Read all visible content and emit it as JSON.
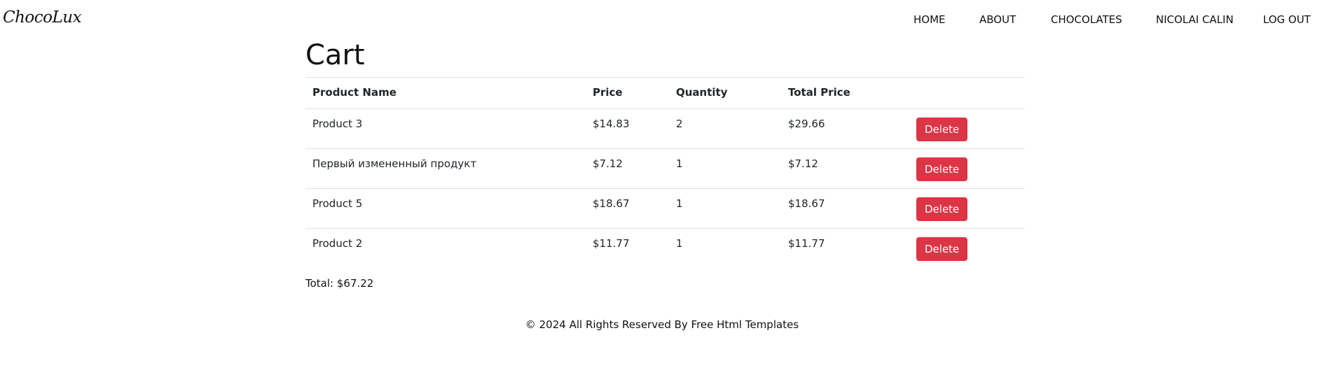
{
  "brand": {
    "logo_text": "ChocoLux"
  },
  "nav": {
    "items": [
      {
        "label": "HOME"
      },
      {
        "label": "ABOUT"
      },
      {
        "label": "CHOCOLATES"
      },
      {
        "label": "NICOLAI CALIN"
      },
      {
        "label": "LOG OUT"
      }
    ]
  },
  "page": {
    "title": "Cart"
  },
  "table": {
    "headers": [
      "Product Name",
      "Price",
      "Quantity",
      "Total Price",
      ""
    ],
    "rows": [
      {
        "name": "Product 3",
        "price": "$14.83",
        "quantity": "2",
        "total": "$29.66",
        "action": "Delete"
      },
      {
        "name": "Первый измененный продукт",
        "price": "$7.12",
        "quantity": "1",
        "total": "$7.12",
        "action": "Delete"
      },
      {
        "name": "Product 5",
        "price": "$18.67",
        "quantity": "1",
        "total": "$18.67",
        "action": "Delete"
      },
      {
        "name": "Product 2",
        "price": "$11.77",
        "quantity": "1",
        "total": "$11.77",
        "action": "Delete"
      }
    ]
  },
  "total": {
    "text": "Total: $67.22"
  },
  "footer": {
    "text": "© 2024 All Rights Reserved By Free Html Templates"
  },
  "colors": {
    "delete_button": "#dc3545",
    "text": "#212529",
    "border": "#dee2e6"
  }
}
